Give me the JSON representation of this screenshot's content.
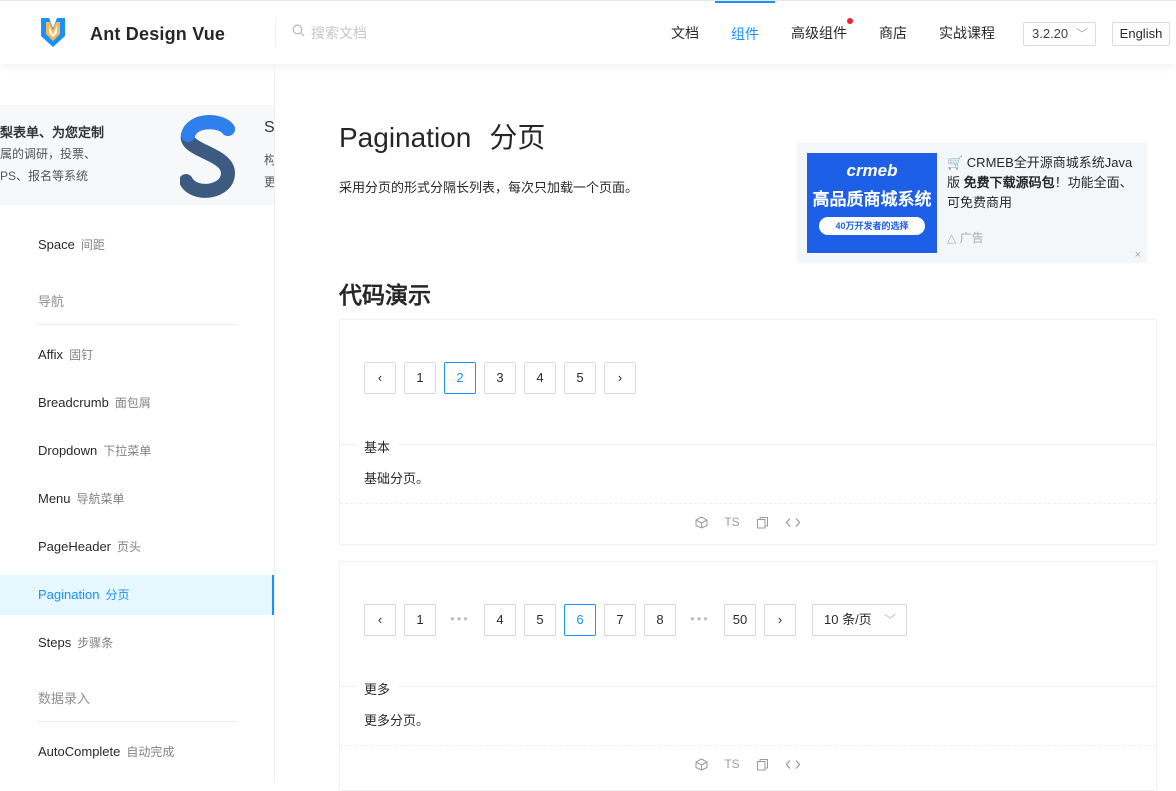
{
  "header": {
    "title": "Ant Design Vue",
    "search_placeholder": "搜索文档",
    "nav": [
      {
        "label": "文档",
        "active": false,
        "dot": false
      },
      {
        "label": "组件",
        "active": true,
        "dot": false
      },
      {
        "label": "高级组件",
        "active": false,
        "dot": true
      },
      {
        "label": "商店",
        "active": false,
        "dot": false
      },
      {
        "label": "实战课程",
        "active": false,
        "dot": false
      }
    ],
    "version": "3.2.20",
    "language": "English",
    "accent_color": "#1890ff"
  },
  "sidebar": {
    "promo": {
      "line1": "梨表单、为您定制",
      "line2": "属的调研，投票、",
      "line3": "PS、报名等系统",
      "side_title": "Su",
      "side_line1": "构",
      "side_line2": "更"
    },
    "items": [
      {
        "type": "item",
        "label": "Space",
        "sub": "间距",
        "active": false
      },
      {
        "type": "group",
        "label": "导航"
      },
      {
        "type": "item",
        "label": "Affix",
        "sub": "固钉",
        "active": false
      },
      {
        "type": "item",
        "label": "Breadcrumb",
        "sub": "面包屑",
        "active": false
      },
      {
        "type": "item",
        "label": "Dropdown",
        "sub": "下拉菜单",
        "active": false
      },
      {
        "type": "item",
        "label": "Menu",
        "sub": "导航菜单",
        "active": false
      },
      {
        "type": "item",
        "label": "PageHeader",
        "sub": "页头",
        "active": false
      },
      {
        "type": "item",
        "label": "Pagination",
        "sub": "分页",
        "active": true
      },
      {
        "type": "item",
        "label": "Steps",
        "sub": "步骤条",
        "active": false
      },
      {
        "type": "group",
        "label": "数据录入"
      },
      {
        "type": "item",
        "label": "AutoComplete",
        "sub": "自动完成",
        "active": false
      }
    ]
  },
  "main": {
    "title_en": "Pagination",
    "title_zh": "分页",
    "description": "采用分页的形式分隔长列表，每次只加载一个页面。",
    "section_title": "代码演示",
    "ad": {
      "image_line1": "crmeb",
      "image_line2": "高品质商城系统",
      "image_line3": "40万开发者的选择",
      "text_prefix": "🛒 CRMEB全开源商城系统Java版 ",
      "text_bold": "免费下载源码包",
      "text_suffix": "！功能全面、可免费商用",
      "tag": "广告",
      "close": "×"
    },
    "demos": [
      {
        "pager": [
          {
            "label": "<",
            "kind": "prev"
          },
          {
            "label": "1",
            "kind": "page"
          },
          {
            "label": "2",
            "kind": "page",
            "active": true
          },
          {
            "label": "3",
            "kind": "page"
          },
          {
            "label": "4",
            "kind": "page"
          },
          {
            "label": "5",
            "kind": "page"
          },
          {
            "label": ">",
            "kind": "next"
          }
        ],
        "meta_title": "基本",
        "meta_desc": "基础分页。"
      },
      {
        "pager": [
          {
            "label": "<",
            "kind": "prev"
          },
          {
            "label": "1",
            "kind": "page"
          },
          {
            "label": "•••",
            "kind": "ellipsis"
          },
          {
            "label": "4",
            "kind": "page"
          },
          {
            "label": "5",
            "kind": "page"
          },
          {
            "label": "6",
            "kind": "page",
            "active": true
          },
          {
            "label": "7",
            "kind": "page"
          },
          {
            "label": "8",
            "kind": "page"
          },
          {
            "label": "•••",
            "kind": "ellipsis"
          },
          {
            "label": "50",
            "kind": "page"
          },
          {
            "label": ">",
            "kind": "next"
          }
        ],
        "size_changer": "10 条/页",
        "meta_title": "更多",
        "meta_desc": "更多分页。"
      }
    ],
    "action_ts_label": "TS"
  }
}
